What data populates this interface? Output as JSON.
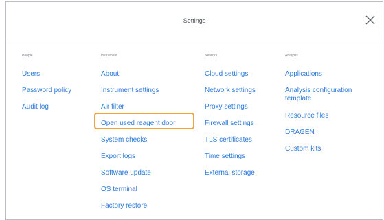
{
  "dialog": {
    "title": "Settings",
    "close_icon": "close-icon"
  },
  "colors": {
    "link": "#2f7bd9",
    "highlight": "#f0a23c"
  },
  "columns": {
    "people": {
      "heading": "People",
      "items": [
        "Users",
        "Password policy",
        "Audit log"
      ]
    },
    "instrument": {
      "heading": "Instrument",
      "items": [
        "About",
        "Instrument settings",
        "Air filter",
        "Open used reagent door",
        "System checks",
        "Export logs",
        "Software update",
        "OS terminal",
        "Factory restore"
      ]
    },
    "network": {
      "heading": "Network",
      "items": [
        "Cloud settings",
        "Network settings",
        "Proxy settings",
        "Firewall settings",
        "TLS certificates",
        "Time settings",
        "External storage"
      ]
    },
    "analysis": {
      "heading": "Analysis",
      "items": [
        "Applications",
        "Analysis configuration template",
        "Resource files",
        "DRAGEN",
        "Custom kits"
      ]
    }
  }
}
